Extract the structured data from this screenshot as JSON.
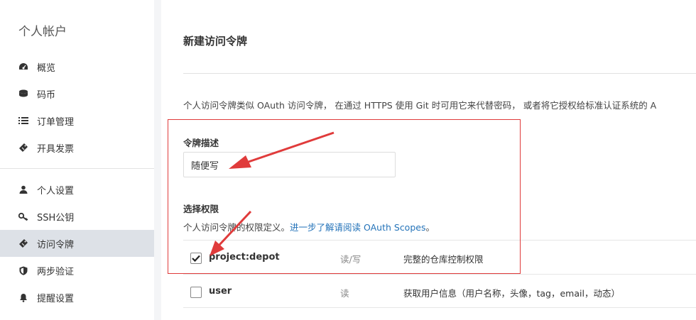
{
  "sidebar": {
    "title": "个人帐户",
    "items": [
      {
        "label": "概览",
        "icon": "dashboard-icon"
      },
      {
        "label": "码币",
        "icon": "coins-icon"
      },
      {
        "label": "订单管理",
        "icon": "list-icon"
      },
      {
        "label": "开具发票",
        "icon": "ticket-icon"
      },
      {
        "label": "个人设置",
        "icon": "user-icon"
      },
      {
        "label": "SSH公钥",
        "icon": "key-icon"
      },
      {
        "label": "访问令牌",
        "icon": "ticket-icon",
        "active": true
      },
      {
        "label": "两步验证",
        "icon": "shield-icon"
      },
      {
        "label": "提醒设置",
        "icon": "bell-icon"
      }
    ]
  },
  "main": {
    "title": "新建访问令牌",
    "intro": "个人访问令牌类似 OAuth 访问令牌， 在通过 HTTPS 使用 Git 时可用它来代替密码， 或者将它授权给标准认证系统的 A",
    "description_label": "令牌描述",
    "description_value": "随便写",
    "scopes_label": "选择权限",
    "scope_help_prefix": "个人访问令牌的权限定义。",
    "scope_help_link": "进一步了解请阅读 OAuth Scopes",
    "scope_help_suffix": "。",
    "scopes": [
      {
        "name": "project:depot",
        "access": "读/写",
        "description": "完整的仓库控制权限",
        "checked": true
      },
      {
        "name": "user",
        "access": "读",
        "description": "获取用户信息（用户名称，头像，tag，email，动态）",
        "checked": false
      }
    ]
  },
  "annotation": {
    "color": "#e03b3b"
  }
}
